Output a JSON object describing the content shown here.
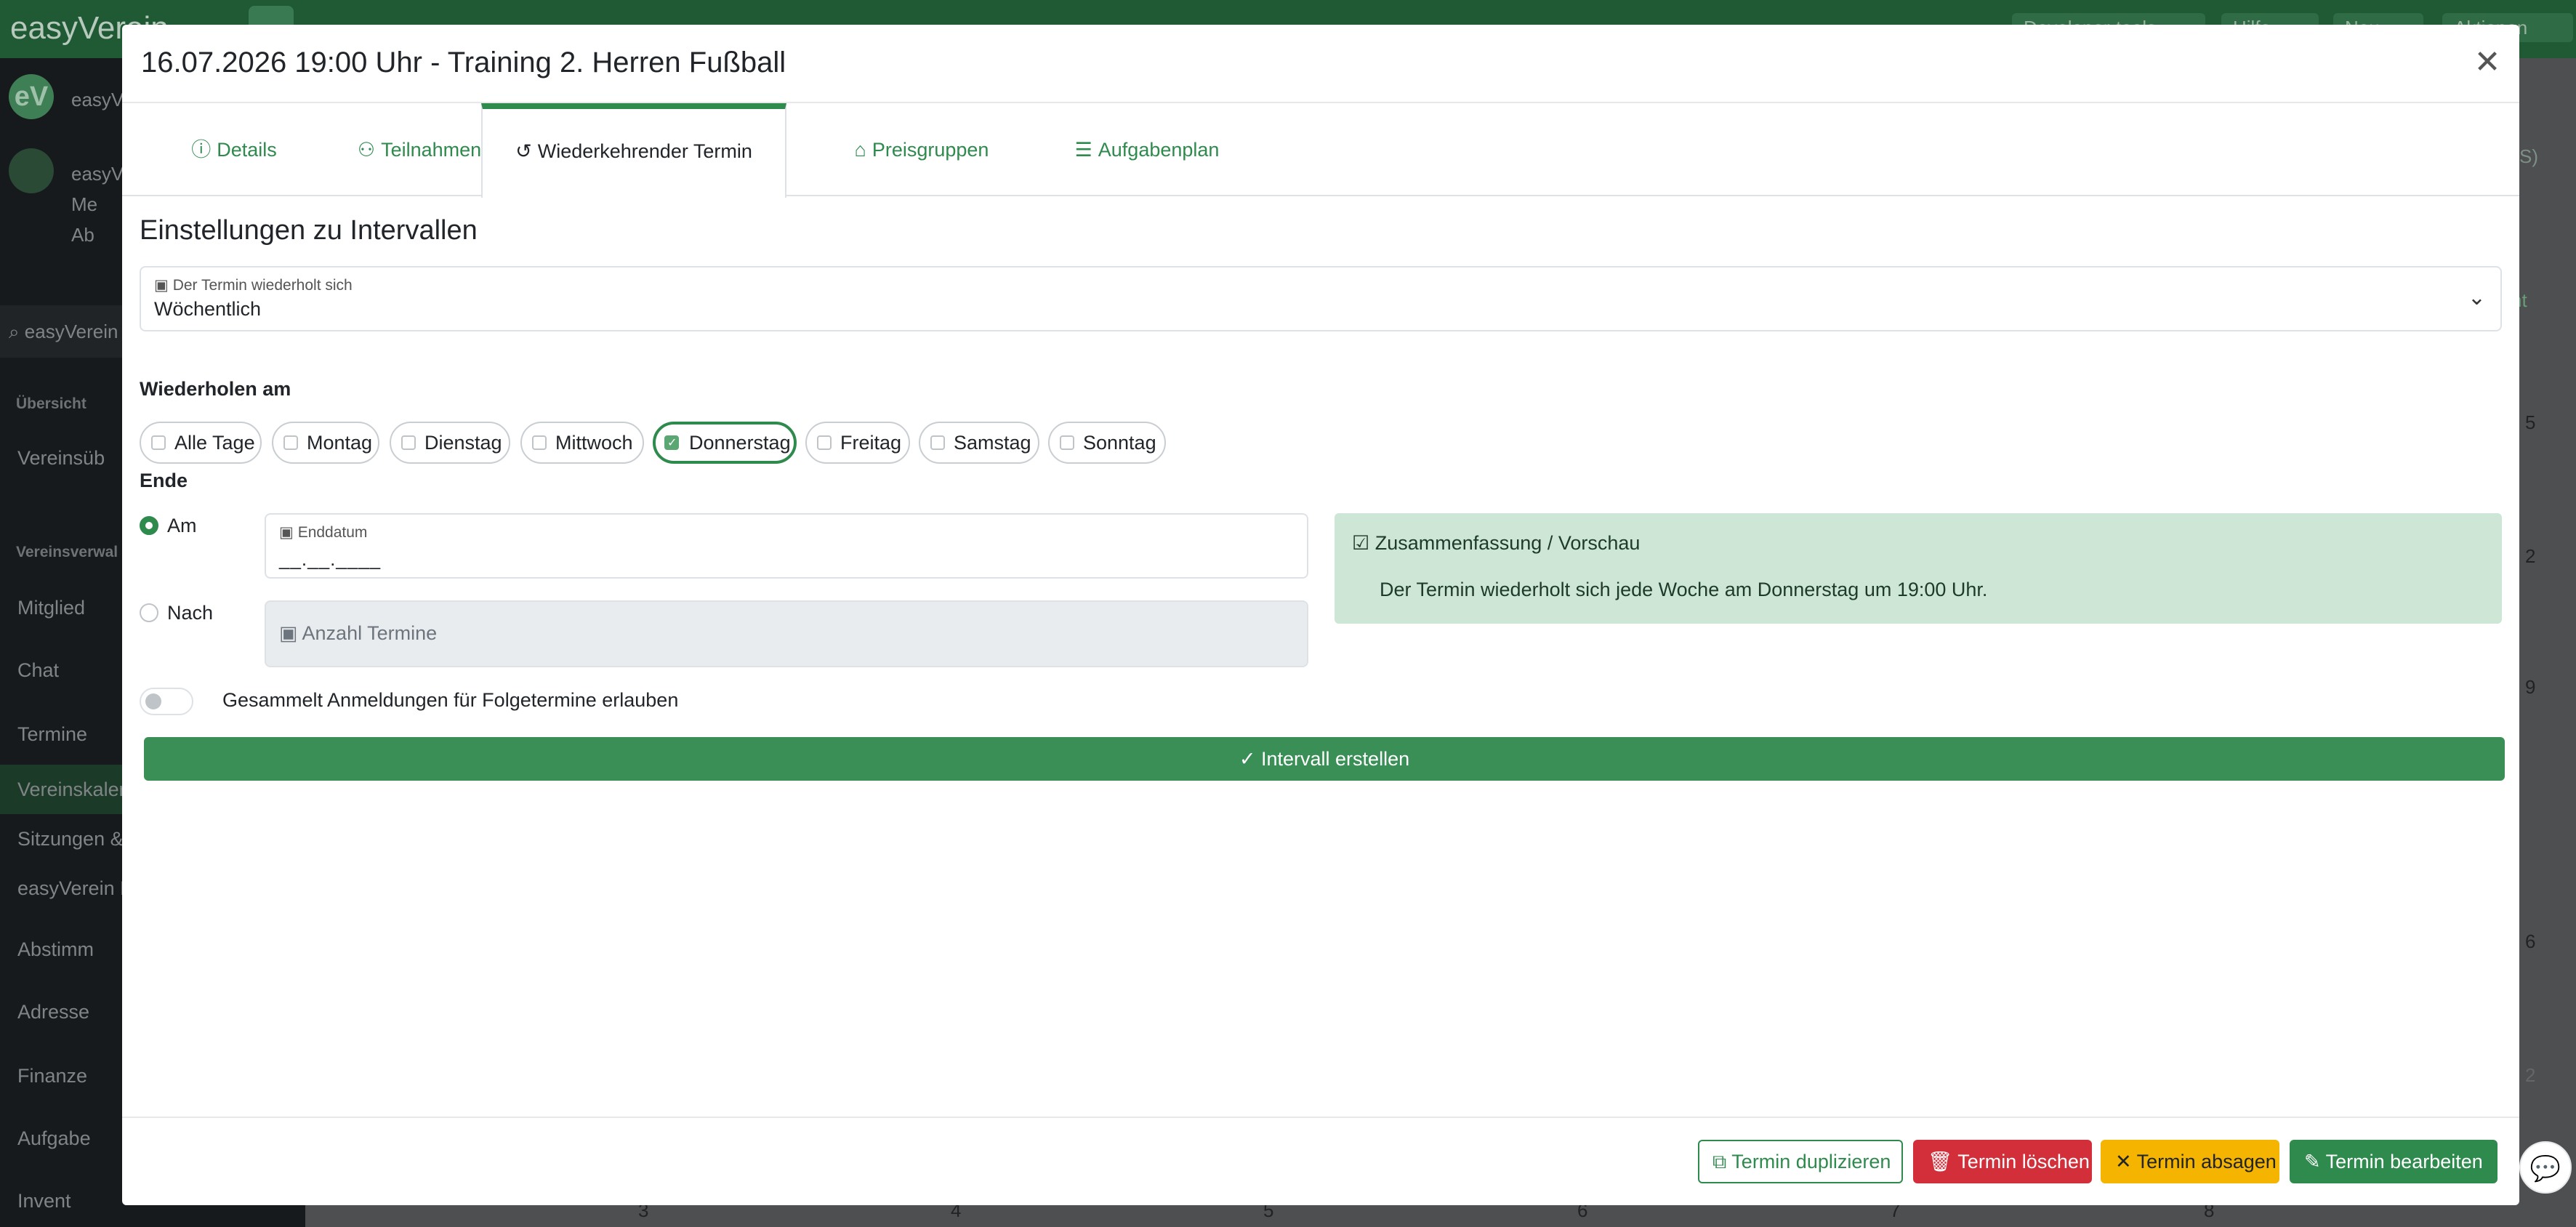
{
  "app": {
    "brand": "easyVerein",
    "top_buttons": [
      "Developer-tools",
      "Hilfe",
      "Neu",
      "Aktionen"
    ]
  },
  "sidebar": {
    "avatar_initials": "eV",
    "org_name": "easyVe",
    "user_name": "easyVe",
    "user_links": [
      "Me",
      "Ab"
    ],
    "search_text": "easyVerein",
    "section_overview": "Übersicht",
    "section_admin": "Vereinsverwal",
    "items": [
      {
        "label": "Vereinsüb",
        "icon": "chart-icon"
      },
      {
        "label": "Mitglied",
        "icon": "users-icon"
      },
      {
        "label": "Chat",
        "icon": "chat-icon"
      },
      {
        "label": "Termine",
        "icon": "calendar-icon"
      },
      {
        "label": "Vereinskaler",
        "icon": ""
      },
      {
        "label": "Sitzungen &",
        "icon": ""
      },
      {
        "label": "easyVerein M",
        "icon": ""
      },
      {
        "label": "Abstimm",
        "icon": "vote-icon"
      },
      {
        "label": "Adresse",
        "icon": "address-icon"
      },
      {
        "label": "Finanze",
        "icon": "money-icon"
      },
      {
        "label": "Aufgabe",
        "icon": "task-icon"
      },
      {
        "label": "Invent",
        "icon": "inventory-icon"
      }
    ]
  },
  "background": {
    "right_frag_top": "S)",
    "right_btn_frag": "cht",
    "calendar_numbers": [
      "5",
      "2",
      "9",
      "6",
      "2"
    ],
    "bottom_numbers": [
      "3",
      "4",
      "5",
      "6",
      "7",
      "8"
    ]
  },
  "modal": {
    "title": "16.07.2026 19:00 Uhr - Training 2. Herren Fußball",
    "tabs": [
      {
        "label": "Details",
        "icon": "info-icon"
      },
      {
        "label": "Teilnahmen",
        "icon": "users-icon"
      },
      {
        "label": "Wiederkehrender Termin",
        "icon": "history-icon"
      },
      {
        "label": "Preisgruppen",
        "icon": "tags-icon"
      },
      {
        "label": "Aufgabenplan",
        "icon": "list-check-icon"
      }
    ],
    "section_title": "Einstellungen zu Intervallen",
    "repeat_select": {
      "label": "Der Termin wiederholt sich",
      "value": "Wöchentlich"
    },
    "repeat_on_label": "Wiederholen am",
    "days": [
      {
        "label": "Alle Tage",
        "checked": false
      },
      {
        "label": "Montag",
        "checked": false
      },
      {
        "label": "Dienstag",
        "checked": false
      },
      {
        "label": "Mittwoch",
        "checked": false
      },
      {
        "label": "Donnerstag",
        "checked": true
      },
      {
        "label": "Freitag",
        "checked": false
      },
      {
        "label": "Samstag",
        "checked": false
      },
      {
        "label": "Sonntag",
        "checked": false
      }
    ],
    "end_label": "Ende",
    "end_on_label": "Am",
    "end_after_label": "Nach",
    "end_date_label": "Enddatum",
    "end_date_value": "__.__.____",
    "count_placeholder": "Anzahl Termine",
    "summary_title": "Zusammenfassung / Vorschau",
    "summary_text": "Der Termin wiederholt sich jede Woche am Donnerstag um 19:00 Uhr.",
    "toggle_label": "Gesammelt Anmeldungen für Folgetermine erlauben",
    "create_button": "Intervall erstellen",
    "footer": {
      "duplicate": "Termin duplizieren",
      "delete": "Termin löschen",
      "cancel": "Termin absagen",
      "edit": "Termin bearbeiten"
    }
  },
  "colors": {
    "primary": "#2f8a4d",
    "danger": "#d32f3a",
    "warning": "#f4b400",
    "summary_bg": "#cde6d6"
  }
}
